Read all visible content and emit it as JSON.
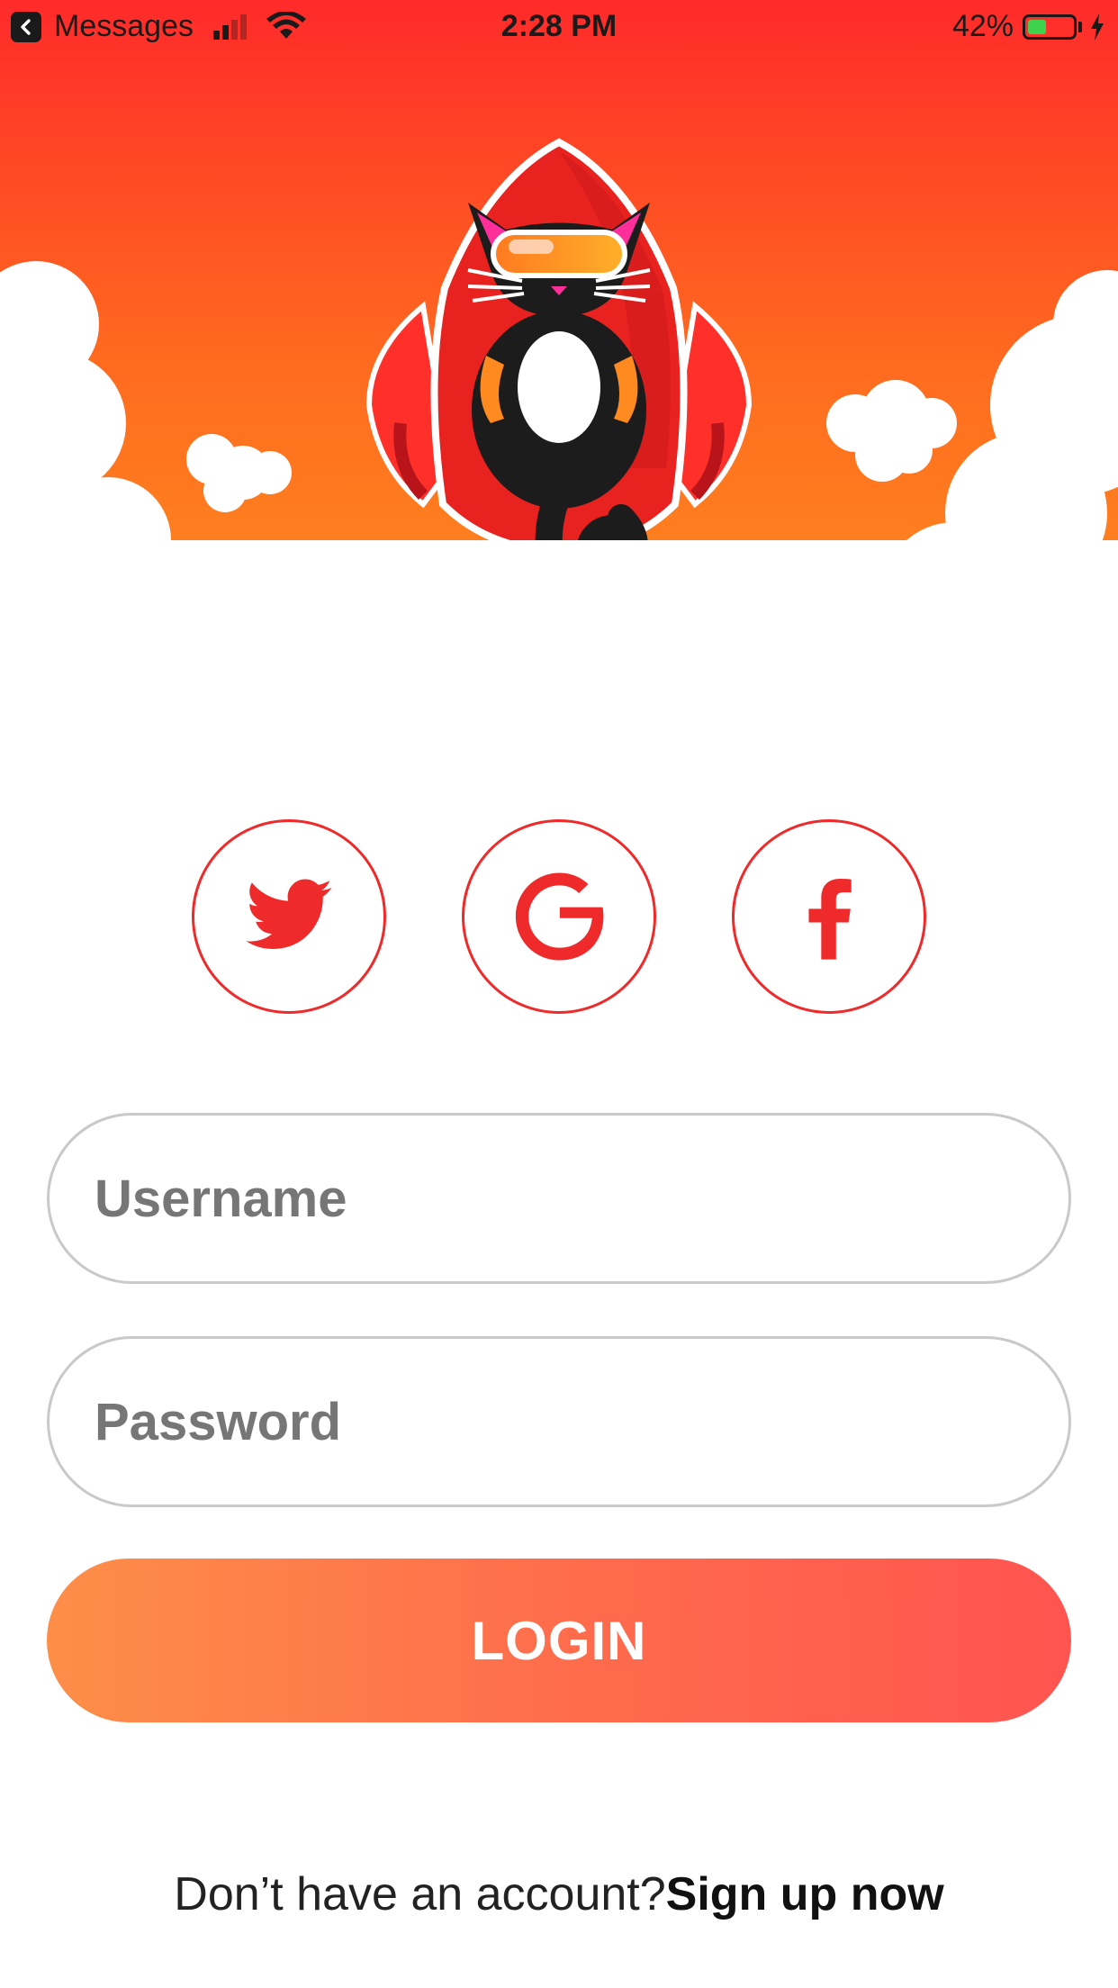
{
  "status_bar": {
    "carrier": "Messages",
    "time": "2:28 PM",
    "battery_pct": "42%",
    "battery_level": 0.42,
    "signal_bars_active": 2,
    "signal_bars_total": 4
  },
  "hero": {
    "illustration": "cat-rocket-mascot",
    "colors": {
      "sky_top": "#ff2a2a",
      "sky_bottom": "#ff9a1f",
      "rocket": "#e8231f",
      "flame": "#ffe43a"
    }
  },
  "social": {
    "buttons": [
      {
        "id": "twitter",
        "icon": "twitter-icon"
      },
      {
        "id": "google",
        "icon": "google-icon"
      },
      {
        "id": "facebook",
        "icon": "facebook-icon"
      }
    ],
    "accent_color": "#ef2a2a"
  },
  "form": {
    "username_placeholder": "Username",
    "username_value": "",
    "password_placeholder": "Password",
    "password_value": "",
    "login_label": "LOGIN"
  },
  "footer": {
    "prompt": "Don’t have an account?",
    "link": "Sign up now"
  }
}
